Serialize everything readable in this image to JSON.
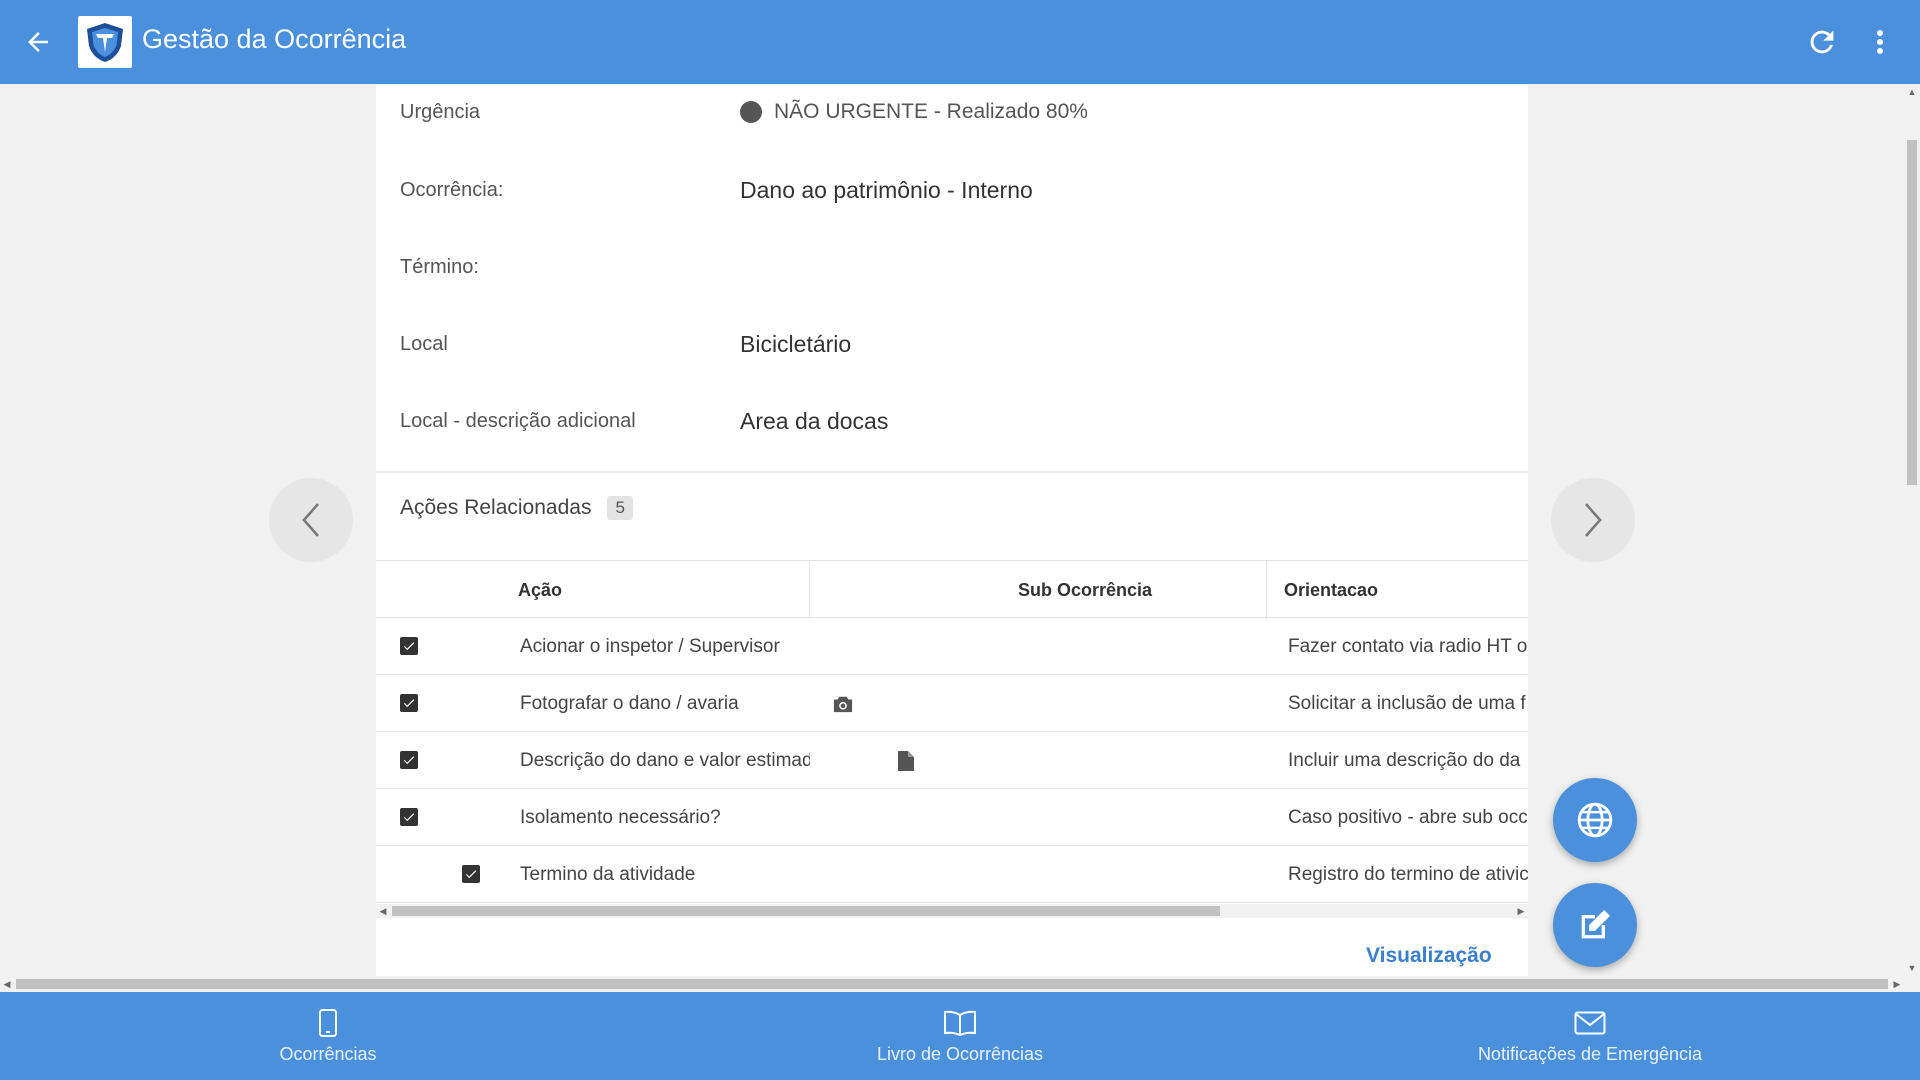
{
  "header": {
    "title": "Gestão da Ocorrência"
  },
  "details": {
    "urgencia": {
      "label": "Urgência",
      "value": "NÃO URGENTE - Realizado 80%"
    },
    "ocorrencia": {
      "label": "Ocorrência:",
      "value": "Dano ao patrimônio - Interno"
    },
    "termino": {
      "label": "Término:",
      "value": ""
    },
    "local": {
      "label": "Local",
      "value": "Bicicletário"
    },
    "local_desc": {
      "label": "Local - descrição adicional",
      "value": "Area da docas"
    }
  },
  "acoes": {
    "title": "Ações Relacionadas",
    "count": "5",
    "columns": {
      "acao": "Ação",
      "sub_ocorrencia": "Sub Ocorrência",
      "orientacao": "Orientacao"
    },
    "rows": [
      {
        "acao": "Acionar o inspetor / Supervisor",
        "orientacao": "Fazer contato via radio HT o",
        "checked": true,
        "icon": ""
      },
      {
        "acao": "Fotografar o dano / avaria",
        "orientacao": "Solicitar a inclusão de uma f",
        "checked": true,
        "icon": "camera-icon"
      },
      {
        "acao": "Descrição do dano e valor estimad",
        "orientacao": "Incluir uma descrição do da",
        "checked": true,
        "icon": "document-icon"
      },
      {
        "acao": "Isolamento necessário?",
        "orientacao": "Caso positivo - abre sub occ",
        "checked": true,
        "icon": ""
      },
      {
        "acao": "Termino da atividade",
        "orientacao": "Registro do termino de ativic",
        "checked": true,
        "icon": ""
      }
    ]
  },
  "visualizacao_label": "Visualização",
  "bottom_nav": {
    "ocorrencias": "Ocorrências",
    "livro": "Livro de Ocorrências",
    "notificacoes": "Notificações de Emergência"
  },
  "colors": {
    "primary": "#4a90dd",
    "link": "#3a7fcf"
  }
}
